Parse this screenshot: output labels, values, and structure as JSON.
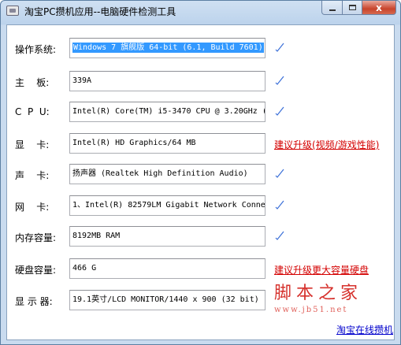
{
  "window": {
    "title": "淘宝PC攒机应用--电脑硬件检测工具",
    "close_label": "x"
  },
  "rows": [
    {
      "label": "操作系统:",
      "value": "Windows 7 旗舰版 64-bit (6.1, Build 7601)",
      "selected": true
    },
    {
      "label": "主    板:",
      "value": "339A"
    },
    {
      "label": "C  P  U:",
      "value": "Intel(R) Core(TM) i5-3470 CPU @ 3.20GHz (",
      "suffix": ""
    },
    {
      "label": "显    卡:",
      "value": "Intel(R) HD Graphics/64 MB",
      "advice": "建议升级(视频/游戏性能)"
    },
    {
      "label": "声    卡:",
      "value": "扬声器 (Realtek High Definition Audio)"
    },
    {
      "label": "网    卡:",
      "value": "1、Intel(R) 82579LM Gigabit Network Conne"
    },
    {
      "label": "内存容量:",
      "value": "8192MB RAM"
    },
    {
      "label": "硬盘容量:",
      "value": "466 G",
      "advice": "建议升级更大容量硬盘"
    },
    {
      "label": "显 示 器:",
      "value": "19.1英寸/LCD MONITOR/1440 x 900 (32 bit)"
    }
  ],
  "watermark": {
    "text": "脚本之家",
    "url": "www.jb51.net"
  },
  "footer": {
    "link": "淘宝在线攒机"
  },
  "colors": {
    "check": "#3a6fd8",
    "advice": "#d40000",
    "link": "#0000cc",
    "selection": "#3399ff"
  }
}
